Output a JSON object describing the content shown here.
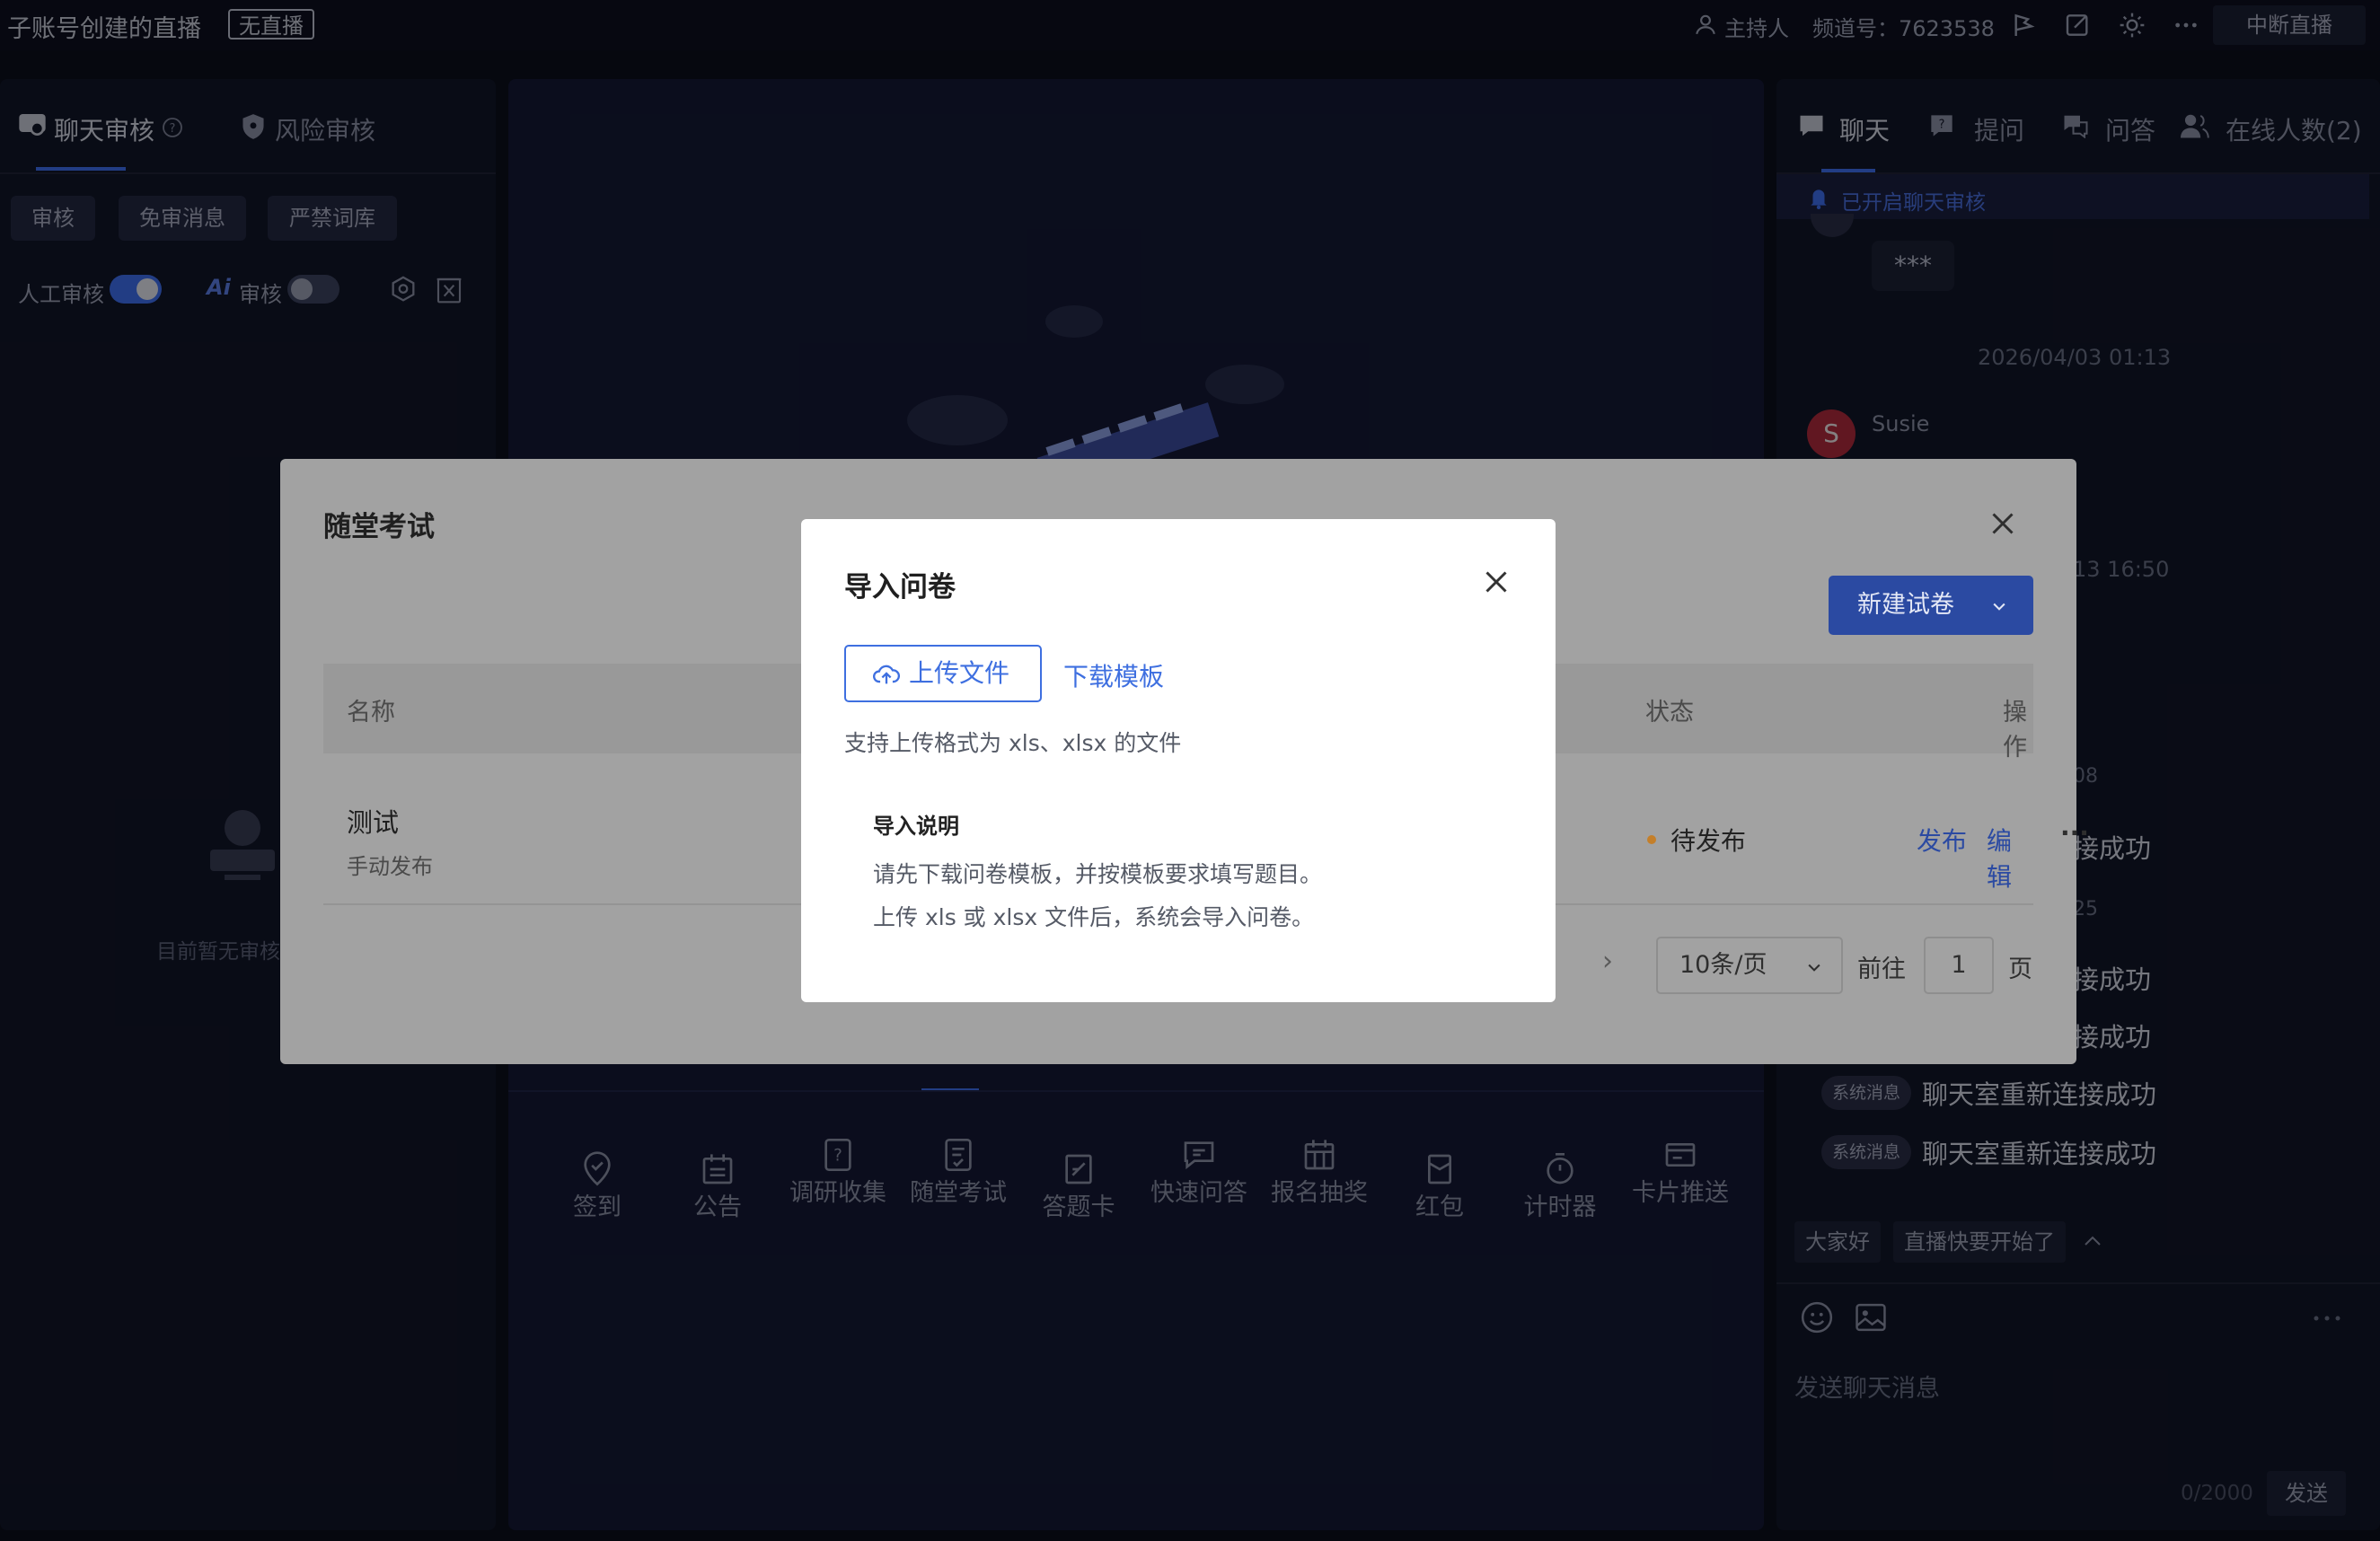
{
  "topbar": {
    "title": "子账号创建的直播",
    "status_badge": "无直播",
    "role": "主持人",
    "channel": "频道号：7623538",
    "end_button": "中断直播"
  },
  "left_panel": {
    "tabs": [
      {
        "label": "聊天审核",
        "icon": "chat-review-icon"
      },
      {
        "label": "风险审核",
        "icon": "shield-icon"
      }
    ],
    "sub_tabs": [
      "审核",
      "免审消息",
      "严禁词库"
    ],
    "manual_review_label": "人工审核",
    "ai_label": "Ai",
    "ai_review_label": "审核",
    "manual_review_on": true,
    "ai_review_on": false,
    "empty_text": "目前暂无审核"
  },
  "center_panel": {
    "tools": [
      "签到",
      "公告",
      "调研收集",
      "随堂考试",
      "答题卡",
      "快速问答",
      "报名抽奖",
      "红包",
      "计时器",
      "卡片推送"
    ]
  },
  "right_panel": {
    "tabs": [
      "聊天",
      "提问",
      "问答",
      "在线人数(2)"
    ],
    "notice": "已开启聊天审核",
    "masked_message": "***",
    "timestamp_1": "2026/04/03 01:13",
    "user_initial": "S",
    "user_name": "Susie",
    "timestamp_2": "13 16:50",
    "partial_time_1": "08",
    "partial_time_2": "25",
    "partial_msg": "接成功",
    "system_tag": "系统消息",
    "system_message": "聊天室重新连接成功",
    "quick_replies": [
      "大家好",
      "直播快要开始了"
    ],
    "input_placeholder": "发送聊天消息",
    "char_count": "0/2000",
    "send_label": "发送"
  },
  "exam_modal": {
    "title": "随堂考试",
    "new_button": "新建试卷",
    "columns": {
      "name": "名称",
      "status": "状态",
      "actions": "操作"
    },
    "rows": [
      {
        "name": "测试",
        "subtitle": "手动发布",
        "status": "待发布",
        "publish": "发布",
        "edit": "编辑",
        "more": "···"
      }
    ],
    "pager": {
      "page_size": "10条/页",
      "goto_label": "前往",
      "page_value": "1",
      "page_suffix": "页",
      "next": "›"
    }
  },
  "import_dialog": {
    "title": "导入问卷",
    "upload_button": "上传文件",
    "download_link": "下载模板",
    "hint": "支持上传格式为 xls、xlsx 的文件",
    "note_title": "导入说明",
    "note_line1": "请先下载问卷模板，并按模板要求填写题目。",
    "note_line2": "上传 xls 或 xlsx 文件后，系统会导入问卷。"
  },
  "colors": {
    "accent": "#3e6fe0",
    "status_dot": "#e0922c",
    "primary_button": "#2b4aa2"
  }
}
